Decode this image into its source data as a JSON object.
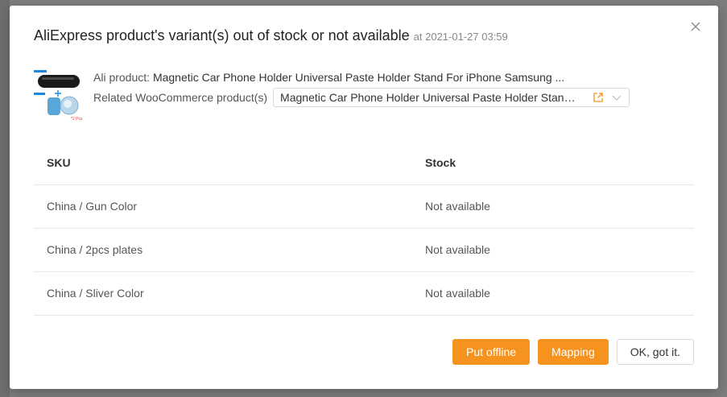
{
  "dialog": {
    "title": "AliExpress product's variant(s) out of stock or not available",
    "timestamp": "at 2021-01-27 03:59"
  },
  "product": {
    "ali_label": "Ali product:",
    "ali_name": "Magnetic Car Phone Holder Universal Paste Holder Stand For iPhone Samsung ...",
    "woo_label": "Related WooCommerce product(s)",
    "woo_selected": "Magnetic Car Phone Holder Universal Paste Holder Stand For iPhone Samsung",
    "thumb_caption": "*2 Pcs"
  },
  "table": {
    "headers": {
      "sku": "SKU",
      "stock": "Stock"
    },
    "rows": [
      {
        "sku": "China / Gun Color",
        "stock": "Not available"
      },
      {
        "sku": "China / 2pcs plates",
        "stock": "Not available"
      },
      {
        "sku": "China / Sliver Color",
        "stock": "Not available"
      }
    ]
  },
  "footer": {
    "put_offline": "Put offline",
    "mapping": "Mapping",
    "ok": "OK, got it."
  },
  "colors": {
    "accent": "#f6931e",
    "link_icon": "#f6931e"
  },
  "icons": {
    "close": "close-icon",
    "external_link": "external-link-icon",
    "dropdown": "chevron-down-icon"
  }
}
